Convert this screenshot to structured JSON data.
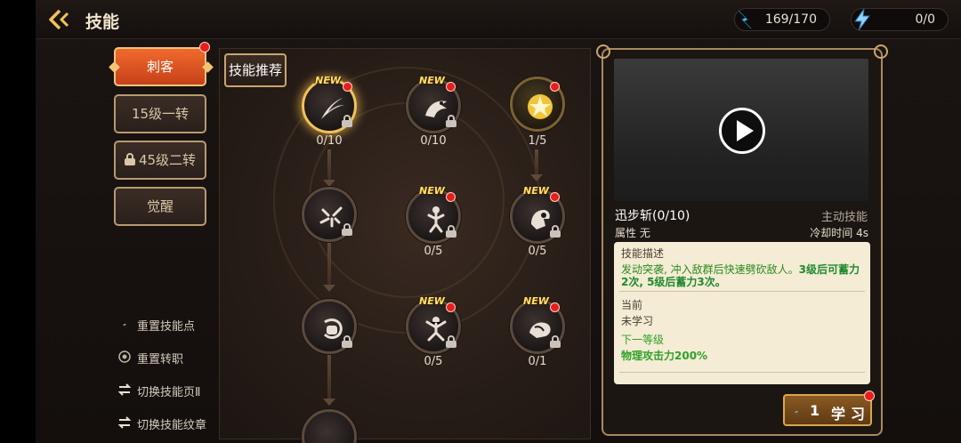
{
  "header": {
    "title": "技能",
    "resources": [
      {
        "icon": "skill-point-icon",
        "value": "169/170"
      },
      {
        "icon": "lightning-icon",
        "value": "0/0"
      }
    ]
  },
  "class_tabs": [
    {
      "label": "刺客",
      "active": true,
      "red_dot": true
    },
    {
      "label": "15级一转",
      "active": false
    },
    {
      "label": "45级二转",
      "active": false,
      "locked": true
    },
    {
      "label": "觉醒",
      "active": false
    }
  ],
  "side_actions": [
    {
      "label": "重置技能点",
      "icon": "reset-points-icon"
    },
    {
      "label": "重置转职",
      "icon": "reset-class-icon"
    },
    {
      "label": "切换技能页Ⅱ",
      "icon": "switch-icon"
    },
    {
      "label": "切换技能纹章",
      "icon": "switch-icon"
    }
  ],
  "recommend_label": "技能推荐",
  "new_label": "NEW",
  "skills": [
    {
      "level": "0/10",
      "icon": "slash-icon",
      "new": true,
      "red_dot": true,
      "locked": true,
      "selected": true
    },
    {
      "level": "0/10",
      "icon": "dragon-icon",
      "new": true,
      "red_dot": true,
      "locked": true
    },
    {
      "level": "1/5",
      "icon": "star-strike-icon",
      "new": false,
      "red_dot": true,
      "locked": false
    },
    {
      "level": "",
      "icon": "burst-icon",
      "new": false,
      "red_dot": false,
      "locked": true
    },
    {
      "level": "0/5",
      "icon": "summon-figure-icon",
      "new": true,
      "red_dot": true,
      "locked": true
    },
    {
      "level": "0/5",
      "icon": "grab-icon",
      "new": true,
      "red_dot": true,
      "locked": true
    },
    {
      "level": "",
      "icon": "whirl-fist-icon",
      "new": false,
      "red_dot": false,
      "locked": true
    },
    {
      "level": "0/5",
      "icon": "warrior-icon",
      "new": true,
      "red_dot": true,
      "locked": true
    },
    {
      "level": "0/1",
      "icon": "beast-icon",
      "new": true,
      "red_dot": true,
      "locked": true
    }
  ],
  "detail": {
    "name": "迅步斩(0/10)",
    "type": "主动技能",
    "attribute": "属性 无",
    "cooldown": "冷却时间  4s",
    "desc_header": "技能描述",
    "desc_text_1": "发动突袭, 冲入敌群后快速劈砍敌人。",
    "desc_text_2": "3级后可蓄力2次, 5级后蓄力3次。",
    "current_header": "当前",
    "current_value": "未学习",
    "next_header": "下一等级",
    "next_value": "物理攻击力200%"
  },
  "learn_button": {
    "count": "1",
    "label": "学习"
  }
}
